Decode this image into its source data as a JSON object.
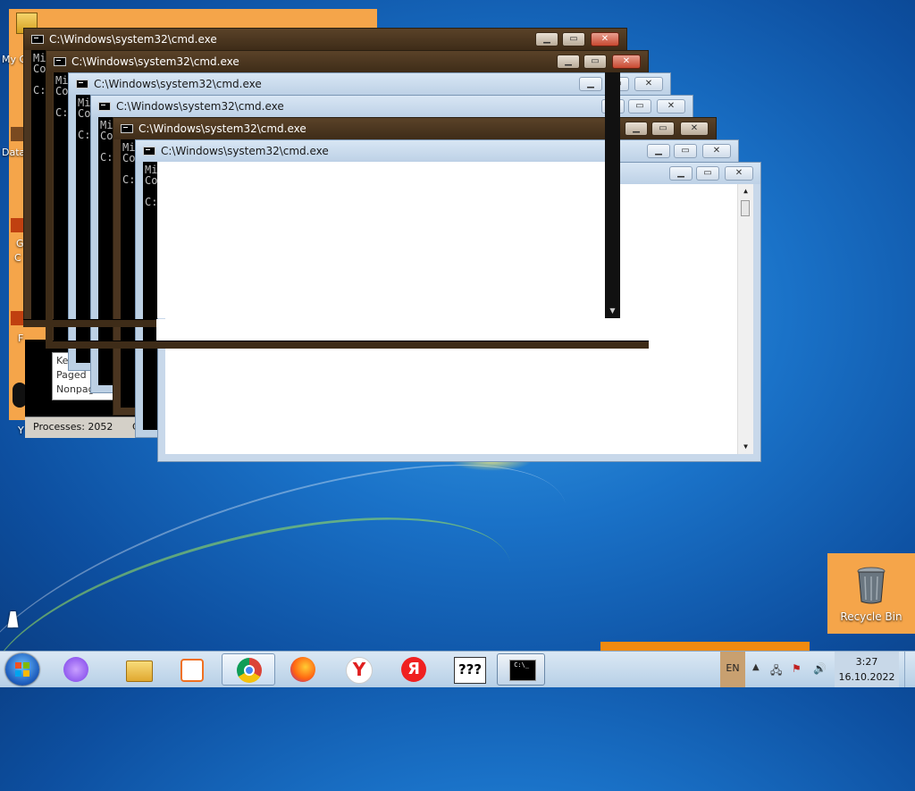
{
  "desktop": {
    "icons": [
      {
        "label": "My C"
      },
      {
        "label": "Data"
      },
      {
        "label": "G"
      },
      {
        "label": "C"
      },
      {
        "label": "F"
      },
      {
        "label": "Y"
      }
    ],
    "recycle_bin": {
      "label": "Recycle Bin",
      "icon": "recycle-bin-icon"
    }
  },
  "cmd": {
    "title": "C:\\Windows\\system32\\cmd.exe",
    "line1": "Mi",
    "line2": "Co",
    "line3": "C:"
  },
  "task_manager": {
    "box_line1": "Ke",
    "box_line2": "Paged",
    "box_line3": "Nonpag",
    "status_text": "Processes: 2052",
    "status_extra": "C"
  },
  "taskbar": {
    "items": [
      {
        "name": "alice-assistant-icon"
      },
      {
        "name": "file-explorer-icon"
      },
      {
        "name": "media-player-icon"
      },
      {
        "name": "chrome-icon"
      },
      {
        "name": "firefox-icon"
      },
      {
        "name": "yandex-browser-icon"
      },
      {
        "name": "yandex-icon"
      },
      {
        "name": "unknown-app-icon",
        "label": "???"
      },
      {
        "name": "cmd-icon"
      }
    ],
    "language": "EN",
    "time": "3:27",
    "date": "16.10.2022"
  },
  "colors": {
    "window_frame_dark": "#4a3520",
    "window_frame_light": "#bcd0e4",
    "orange_highlight": "#f5a54a",
    "desktop_blue": "#1a72c8"
  }
}
